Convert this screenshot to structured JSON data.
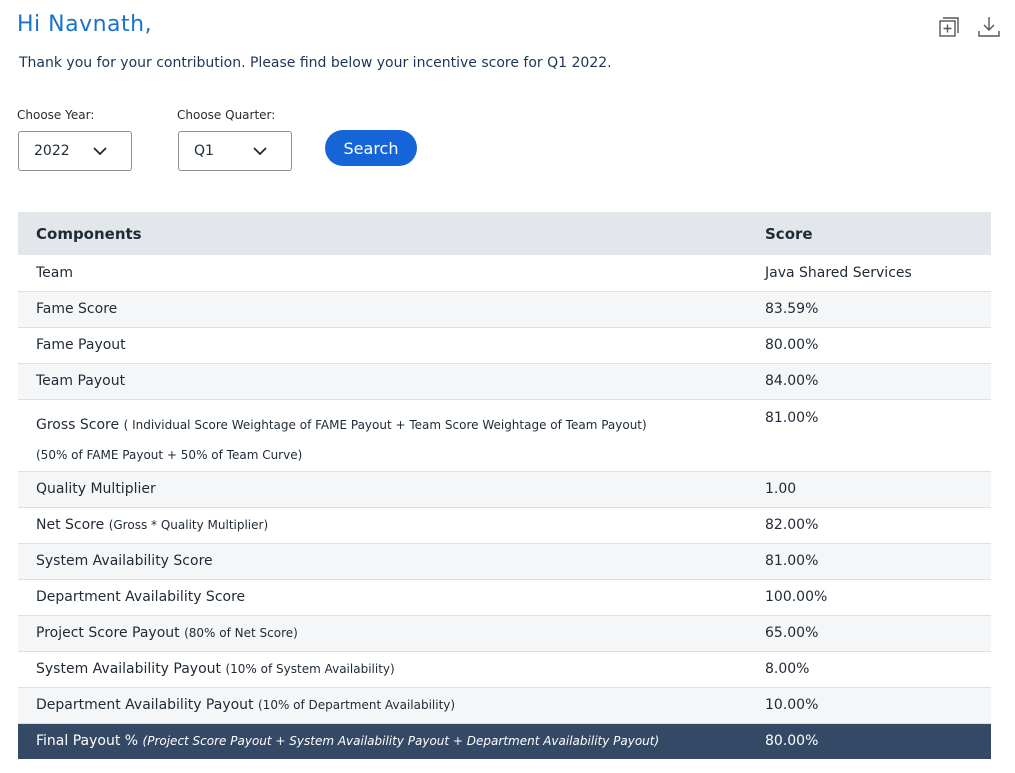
{
  "header": {
    "greeting": "Hi Navnath,",
    "subtitle": "Thank you for your contribution. Please find below your incentive score for  Q1 2022.",
    "icons": [
      "expand-icon",
      "download-icon"
    ]
  },
  "filters": {
    "year_label": "Choose Year:",
    "year_value": "2022",
    "quarter_label": "Choose Quarter:",
    "quarter_value": "Q1",
    "search_label": "Search"
  },
  "table": {
    "headers": {
      "component": "Components",
      "score": "Score"
    },
    "rows": [
      {
        "label": "Team",
        "note": "",
        "value": "Java Shared Services"
      },
      {
        "label": "Fame Score",
        "note": "",
        "value": "83.59%"
      },
      {
        "label": "Fame Payout",
        "note": "",
        "value": "80.00%"
      },
      {
        "label": "Team Payout",
        "note": "",
        "value": "84.00%"
      },
      {
        "label": "Gross Score",
        "note": "( Individual Score Weightage of FAME Payout + Team Score Weightage of Team Payout)",
        "note2": "(50% of FAME Payout + 50% of Team Curve)",
        "value": "81.00%"
      },
      {
        "label": "Quality Multiplier",
        "note": "",
        "value": "1.00"
      },
      {
        "label": "Net Score",
        "note": "(Gross * Quality Multiplier)",
        "value": "82.00%"
      },
      {
        "label": "System Availability  Score",
        "note": "",
        "value": "81.00%"
      },
      {
        "label": "Department Availability Score",
        "note": "",
        "value": "100.00%"
      },
      {
        "label": "Project Score Payout",
        "note": "(80% of Net Score)",
        "value": "65.00%"
      },
      {
        "label": "System Availability Payout",
        "note": "(10% of System Availability)",
        "value": "8.00%"
      },
      {
        "label": "Department  Availability Payout",
        "note": "(10% of Department Availability)",
        "value": "10.00%"
      }
    ],
    "final": {
      "label": "Final Payout %",
      "note": "(Project Score Payout + System Availability Payout + Department Availability Payout)",
      "value": "80.00%"
    }
  },
  "colors": {
    "accent": "#1565d8",
    "greeting": "#1a73c8",
    "header_bg": "#e3e6ea",
    "final_row_bg": "#344966"
  }
}
